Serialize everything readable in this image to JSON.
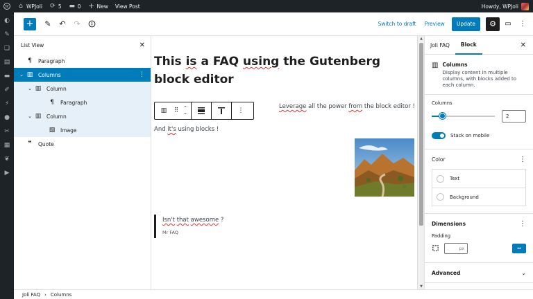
{
  "admin_bar": {
    "site_name": "WPJoli",
    "updates_count": "5",
    "comments_count": "0",
    "new_label": "New",
    "view_post_label": "View Post",
    "greeting": "Howdy, WPJoli"
  },
  "header": {
    "switch_to_draft": "Switch to draft",
    "preview": "Preview",
    "update": "Update"
  },
  "list_view": {
    "title": "List View",
    "items": [
      {
        "label": "Paragraph",
        "icon": "paragraph-icon"
      },
      {
        "label": "Columns",
        "icon": "columns-icon"
      },
      {
        "label": "Column",
        "icon": "column-icon"
      },
      {
        "label": "Paragraph",
        "icon": "paragraph-icon"
      },
      {
        "label": "Column",
        "icon": "column-icon"
      },
      {
        "label": "Image",
        "icon": "image-icon"
      },
      {
        "label": "Quote",
        "icon": "quote-icon"
      }
    ]
  },
  "canvas": {
    "title_parts": [
      "This ",
      "is",
      " a FAQ ",
      "using",
      " the Gutenberg block editor"
    ],
    "column_right_parts": [
      "Leverage",
      " all the power ",
      "from",
      " the block editor !"
    ],
    "column_left_parts": [
      "And ",
      "it's",
      " using blocks !"
    ],
    "quote_parts": [
      "Isn't",
      " ",
      "that",
      " ",
      "awesome",
      " ?"
    ],
    "quote_citation": "Mr FAQ"
  },
  "settings": {
    "tab_document": "Joli FAQ",
    "tab_block": "Block",
    "block_name": "Columns",
    "block_description": "Display content in multiple columns, with blocks added to each column.",
    "columns_label": "Columns",
    "columns_value": "2",
    "columns_slider_fraction": 0.17,
    "stack_on_mobile_label": "Stack on mobile",
    "color_heading": "Color",
    "color_text": "Text",
    "color_background": "Background",
    "dimensions_heading": "Dimensions",
    "padding_label": "Padding",
    "padding_unit": "px",
    "advanced_heading": "Advanced"
  },
  "breadcrumb": {
    "items": [
      "Joli FAQ",
      "Columns"
    ]
  },
  "colors": {
    "accent": "#007cba",
    "admin_bar": "#1d2327"
  }
}
